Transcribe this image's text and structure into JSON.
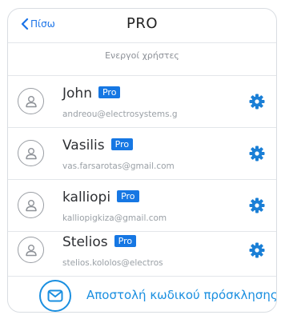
{
  "header": {
    "back_label": "Πίσω",
    "title": "PRO"
  },
  "section_title": "Ενεργοί χρήστες",
  "users": [
    {
      "name": "John",
      "badge": "Pro",
      "email": "andreou@electrosystems.g"
    },
    {
      "name": "Vasilis",
      "badge": "Pro",
      "email": "vas.farsarotas@gmail.com"
    },
    {
      "name": "kalliopi",
      "badge": "Pro",
      "email": "kalliopigkiza@gmail.com"
    },
    {
      "name": "Stelios",
      "badge": "Pro",
      "email": "stelios.kololos@electros"
    }
  ],
  "invite": {
    "label": "Αποστολή κωδικού πρόσκλησης"
  },
  "colors": {
    "accent": "#1a73e8",
    "badge": "#1677e3",
    "invite": "#1a8fe0"
  }
}
